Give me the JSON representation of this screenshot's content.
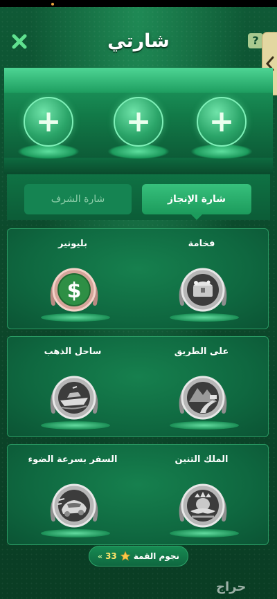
{
  "header": {
    "title": "شارتي",
    "help_symbol": "?"
  },
  "slots": [
    {
      "name": "empty-badge-slot",
      "symbol": "+"
    },
    {
      "name": "empty-badge-slot",
      "symbol": "+"
    },
    {
      "name": "empty-badge-slot",
      "symbol": "+"
    }
  ],
  "tabs": {
    "achievement": "شارة الإنجاز",
    "honor": "شارة الشرف"
  },
  "badges": [
    {
      "label": "فخامة",
      "icon": "treasure-chest-icon"
    },
    {
      "label": "بليونير",
      "icon": "dollar-icon"
    },
    {
      "label": "على الطريق",
      "icon": "road-icon"
    },
    {
      "label": "ساحل الذهب",
      "icon": "yacht-icon"
    },
    {
      "label": "الملك التنين",
      "icon": "dragon-king-icon"
    },
    {
      "label": "السفر بسرعة الضوء",
      "icon": "speed-car-icon"
    }
  ],
  "footer": {
    "stars_label": "نجوم القمة",
    "stars_count": "33",
    "chevrons": "«"
  },
  "watermark": "حراج",
  "colors": {
    "background": "#0c4a2c",
    "accent": "#1c9b5c",
    "medal_silver": "#a7a7a7",
    "medal_rose": "#d5a59a",
    "dollar_green": "#2e8f45"
  }
}
